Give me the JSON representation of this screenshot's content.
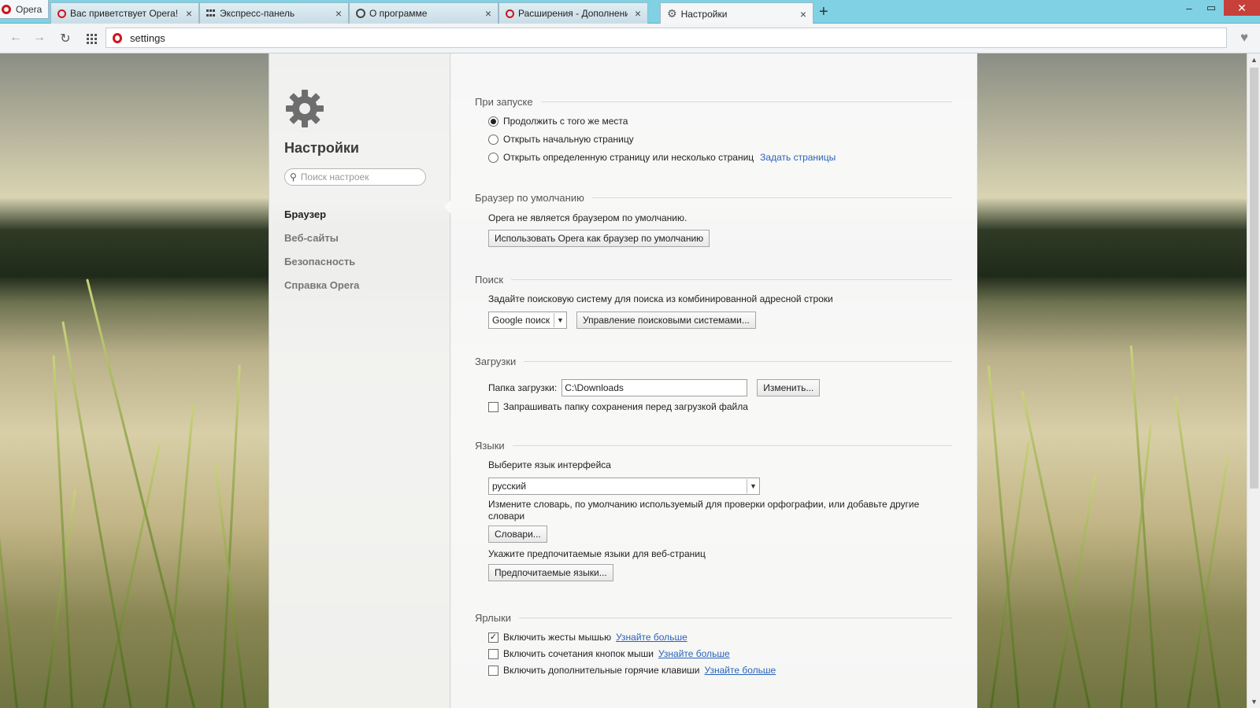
{
  "browser": {
    "menu_label": "Opera",
    "tabs": [
      {
        "label": "Вас приветствует Opera!",
        "icon": "opera-icon"
      },
      {
        "label": "Экспресс-панель",
        "icon": "grid-icon"
      },
      {
        "label": "О программе",
        "icon": "opera-outline-icon"
      },
      {
        "label": "Расширения - Дополнения",
        "icon": "opera-icon"
      },
      {
        "label": "Настройки",
        "icon": "gear-icon",
        "active": true
      }
    ],
    "close_glyph": "×",
    "new_tab_glyph": "+",
    "address": "settings",
    "window_controls": {
      "minimize": "–",
      "maximize": "▭",
      "close": "✕"
    }
  },
  "sidebar": {
    "title": "Настройки",
    "search_placeholder": "Поиск настроек",
    "items": [
      {
        "label": "Браузер",
        "active": true
      },
      {
        "label": "Веб-сайты"
      },
      {
        "label": "Безопасность"
      },
      {
        "label": "Справка Opera"
      }
    ]
  },
  "startup": {
    "title": "При запуске",
    "options": [
      {
        "label": "Продолжить с того же места",
        "selected": true
      },
      {
        "label": "Открыть начальную страницу",
        "selected": false
      },
      {
        "label": "Открыть определенную страницу или несколько страниц",
        "selected": false
      }
    ],
    "set_pages_link": "Задать страницы"
  },
  "default_browser": {
    "title": "Браузер по умолчанию",
    "status": "Opera не является браузером по умолчанию.",
    "button": "Использовать Opera как браузер по умолчанию"
  },
  "search": {
    "title": "Поиск",
    "description": "Задайте поисковую систему для поиска из комбинированной адресной строки",
    "engine": "Google поиск",
    "manage_button": "Управление поисковыми системами..."
  },
  "downloads": {
    "title": "Загрузки",
    "folder_label": "Папка загрузки:",
    "folder_value": "C:\\Downloads",
    "change_button": "Изменить...",
    "ask_label": "Запрашивать папку сохранения перед загрузкой файла",
    "ask_checked": false
  },
  "languages": {
    "title": "Языки",
    "ui_label": "Выберите язык интерфейса",
    "ui_value": "русский",
    "dict_text_1": "Измените словарь, по умолчанию используемый для проверки орфографии, или добавьте другие",
    "dict_text_2": "словари",
    "dict_button": "Словари...",
    "preferred_text": "Укажите предпочитаемые языки для веб-страниц",
    "preferred_button": "Предпочитаемые языки..."
  },
  "shortcuts": {
    "title": "Ярлыки",
    "items": [
      {
        "label": "Включить жесты мышью",
        "checked": true,
        "link": "Узнайте больше"
      },
      {
        "label": "Включить сочетания кнопок мыши",
        "checked": false,
        "link": "Узнайте больше"
      },
      {
        "label": "Включить дополнительные горячие клавиши",
        "checked": false,
        "link": "Узнайте больше"
      }
    ]
  },
  "checkmark_glyph": "✓",
  "caret_glyph": "▼",
  "scroll_up_glyph": "▲",
  "scroll_down_glyph": "▼",
  "colors": {
    "accent_link": "#2a63b8",
    "opera_red": "#d3131e",
    "close_red": "#c7403a",
    "titlebar": "#7fd1e3"
  }
}
